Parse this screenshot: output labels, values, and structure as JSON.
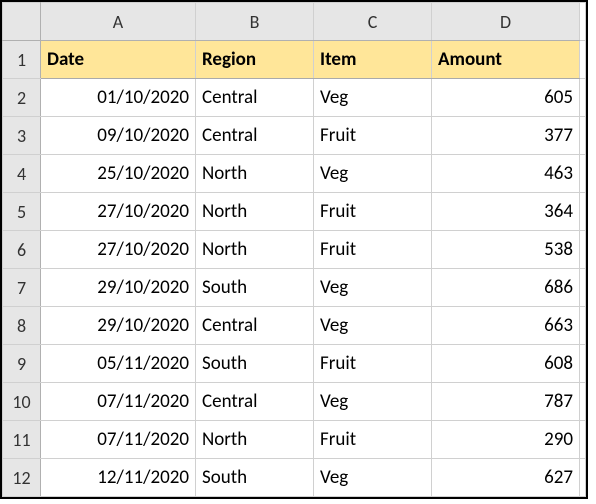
{
  "columns": [
    "A",
    "B",
    "C",
    "D"
  ],
  "rowNumbers": [
    "1",
    "2",
    "3",
    "4",
    "5",
    "6",
    "7",
    "8",
    "9",
    "10",
    "11",
    "12"
  ],
  "headers": {
    "A": "Date",
    "B": "Region",
    "C": "Item",
    "D": "Amount"
  },
  "rows": [
    {
      "date": "01/10/2020",
      "region": "Central",
      "item": "Veg",
      "amount": "605"
    },
    {
      "date": "09/10/2020",
      "region": "Central",
      "item": "Fruit",
      "amount": "377"
    },
    {
      "date": "25/10/2020",
      "region": "North",
      "item": "Veg",
      "amount": "463"
    },
    {
      "date": "27/10/2020",
      "region": "North",
      "item": "Fruit",
      "amount": "364"
    },
    {
      "date": "27/10/2020",
      "region": "North",
      "item": "Fruit",
      "amount": "538"
    },
    {
      "date": "29/10/2020",
      "region": "South",
      "item": "Veg",
      "amount": "686"
    },
    {
      "date": "29/10/2020",
      "region": "Central",
      "item": "Veg",
      "amount": "663"
    },
    {
      "date": "05/11/2020",
      "region": "South",
      "item": "Fruit",
      "amount": "608"
    },
    {
      "date": "07/11/2020",
      "region": "Central",
      "item": "Veg",
      "amount": "787"
    },
    {
      "date": "07/11/2020",
      "region": "North",
      "item": "Fruit",
      "amount": "290"
    },
    {
      "date": "12/11/2020",
      "region": "South",
      "item": "Veg",
      "amount": "627"
    }
  ]
}
